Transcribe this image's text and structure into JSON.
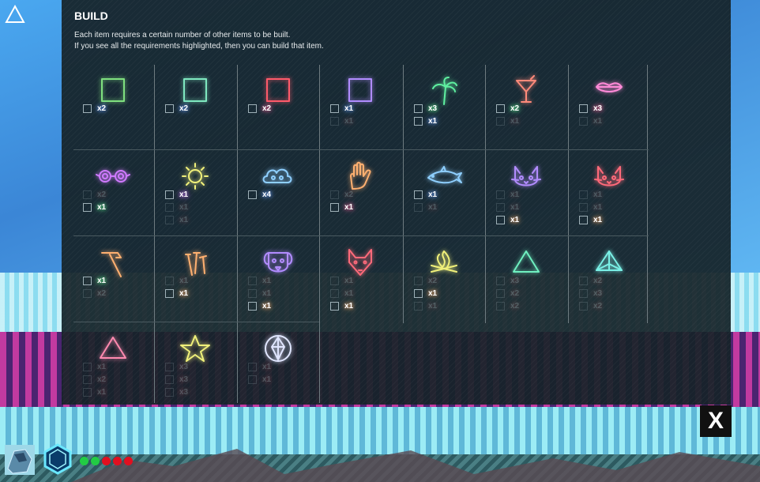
{
  "panel": {
    "title": "BUILD",
    "description_line1": "Each item requires a certain number of other items to be built.",
    "description_line2": "If you see all the requirements highlighted, then you can build that item."
  },
  "colors": {
    "green": "#6ff0a0",
    "blue": "#8ecfff",
    "red": "#ff6a7a",
    "purple": "#b28cff",
    "yellow": "#f0f07a",
    "pink": "#ff8ad8",
    "orange": "#ffb070",
    "cyan": "#7af0e6"
  },
  "items": [
    {
      "icon": "green-square-icon",
      "color": "#7fe07f",
      "reqs": [
        {
          "qty": "x2",
          "lit": true,
          "glow": "#6aa0ff"
        }
      ]
    },
    {
      "icon": "cyan-square-icon",
      "color": "#7fe8c0",
      "reqs": [
        {
          "qty": "x2",
          "lit": true,
          "glow": "#6aa0ff"
        }
      ]
    },
    {
      "icon": "red-square-icon",
      "color": "#ff5a6a",
      "reqs": [
        {
          "qty": "x2",
          "lit": true,
          "glow": "#ff6aa0"
        }
      ]
    },
    {
      "icon": "purple-square-icon",
      "color": "#b08cff",
      "reqs": [
        {
          "qty": "x1",
          "lit": true,
          "glow": "#6aa0ff"
        },
        {
          "qty": "x1",
          "lit": false,
          "glow": "#ff6a6a"
        }
      ]
    },
    {
      "icon": "palm-tree-icon",
      "color": "#5ff0a0",
      "reqs": [
        {
          "qty": "x3",
          "lit": true,
          "glow": "#6aff9a"
        },
        {
          "qty": "x1",
          "lit": true,
          "glow": "#6aa0ff"
        }
      ]
    },
    {
      "icon": "cocktail-icon",
      "color": "#ff8a7a",
      "reqs": [
        {
          "qty": "x2",
          "lit": true,
          "glow": "#6aff9a"
        },
        {
          "qty": "x1",
          "lit": false,
          "glow": "#ff6a6a"
        }
      ]
    },
    {
      "icon": "lips-icon",
      "color": "#ff8ad8",
      "reqs": [
        {
          "qty": "x3",
          "lit": true,
          "glow": "#ff6aa0"
        },
        {
          "qty": "x1",
          "lit": false,
          "glow": "#ff6a6a"
        }
      ]
    },
    {
      "icon": "spiral-glasses-icon",
      "color": "#d07aff",
      "reqs": [
        {
          "qty": "x2",
          "lit": false,
          "glow": "#ff6a6a"
        },
        {
          "qty": "x1",
          "lit": true,
          "glow": "#6aff9a"
        }
      ]
    },
    {
      "icon": "sun-icon",
      "color": "#f0f07a",
      "reqs": [
        {
          "qty": "x1",
          "lit": true,
          "glow": "#d07aff"
        },
        {
          "qty": "x1",
          "lit": false,
          "glow": "#ff6a6a"
        },
        {
          "qty": "x1",
          "lit": false,
          "glow": "#ff6a6a"
        }
      ]
    },
    {
      "icon": "cloud-icon",
      "color": "#8ecfff",
      "reqs": [
        {
          "qty": "x4",
          "lit": true,
          "glow": "#6aa0ff"
        }
      ]
    },
    {
      "icon": "hand-icon",
      "color": "#ffb070",
      "reqs": [
        {
          "qty": "x2",
          "lit": false,
          "glow": "#ff6a6a"
        },
        {
          "qty": "x1",
          "lit": true,
          "glow": "#ff6aa0"
        }
      ]
    },
    {
      "icon": "dolphin-icon",
      "color": "#8ecfff",
      "reqs": [
        {
          "qty": "x1",
          "lit": true,
          "glow": "#6aa0ff"
        },
        {
          "qty": "x1",
          "lit": false,
          "glow": "#ff6a6a"
        }
      ]
    },
    {
      "icon": "cat-icon",
      "color": "#b28cff",
      "reqs": [
        {
          "qty": "x1",
          "lit": false,
          "glow": "#ff6a6a"
        },
        {
          "qty": "x1",
          "lit": false,
          "glow": "#ff6a6a"
        },
        {
          "qty": "x1",
          "lit": true,
          "glow": "#ffb070"
        }
      ]
    },
    {
      "icon": "devil-cat-icon",
      "color": "#ff6a7a",
      "reqs": [
        {
          "qty": "x1",
          "lit": false,
          "glow": "#ff6a6a"
        },
        {
          "qty": "x1",
          "lit": false,
          "glow": "#ff6a6a"
        },
        {
          "qty": "x1",
          "lit": true,
          "glow": "#ffb070"
        }
      ]
    },
    {
      "icon": "hammer-icon",
      "color": "#ffb070",
      "reqs": [
        {
          "qty": "x1",
          "lit": true,
          "glow": "#6aff9a"
        },
        {
          "qty": "x2",
          "lit": false,
          "glow": "#ff6a6a"
        }
      ]
    },
    {
      "icon": "nails-icon",
      "color": "#ffb070",
      "reqs": [
        {
          "qty": "x1",
          "lit": false,
          "glow": "#ff6a6a"
        },
        {
          "qty": "x1",
          "lit": true,
          "glow": "#ffb070"
        }
      ]
    },
    {
      "icon": "dog-icon",
      "color": "#b28cff",
      "reqs": [
        {
          "qty": "x1",
          "lit": false,
          "glow": "#ff6a6a"
        },
        {
          "qty": "x1",
          "lit": false,
          "glow": "#ff6a6a"
        },
        {
          "qty": "x1",
          "lit": true,
          "glow": "#ffb070"
        }
      ]
    },
    {
      "icon": "fox-icon",
      "color": "#ff6a7a",
      "reqs": [
        {
          "qty": "x1",
          "lit": false,
          "glow": "#ff6a6a"
        },
        {
          "qty": "x1",
          "lit": false,
          "glow": "#ff6a6a"
        },
        {
          "qty": "x1",
          "lit": true,
          "glow": "#ffb070"
        }
      ]
    },
    {
      "icon": "campfire-icon",
      "color": "#f0f07a",
      "reqs": [
        {
          "qty": "x2",
          "lit": false,
          "glow": "#ff6a6a"
        },
        {
          "qty": "x1",
          "lit": true,
          "glow": "#ffb070"
        },
        {
          "qty": "x1",
          "lit": false,
          "glow": "#ff6a6a"
        }
      ]
    },
    {
      "icon": "green-triangle-icon",
      "color": "#6ff0c0",
      "reqs": [
        {
          "qty": "x3",
          "lit": false,
          "glow": "#ff6a6a"
        },
        {
          "qty": "x2",
          "lit": false,
          "glow": "#ff6a6a"
        },
        {
          "qty": "x2",
          "lit": false,
          "glow": "#ff6a6a"
        }
      ]
    },
    {
      "icon": "teal-pyramid-icon",
      "color": "#7af0e6",
      "reqs": [
        {
          "qty": "x2",
          "lit": false,
          "glow": "#ff6a6a"
        },
        {
          "qty": "x3",
          "lit": false,
          "glow": "#ff6a6a"
        },
        {
          "qty": "x2",
          "lit": false,
          "glow": "#ff6a6a"
        }
      ]
    },
    {
      "icon": "pink-triangle-icon",
      "color": "#ff8ab0",
      "reqs": [
        {
          "qty": "x1",
          "lit": false,
          "glow": "#ff6a6a"
        },
        {
          "qty": "x2",
          "lit": false,
          "glow": "#ff6a6a"
        },
        {
          "qty": "x1",
          "lit": false,
          "glow": "#ff6a6a"
        }
      ]
    },
    {
      "icon": "star-icon",
      "color": "#f0f07a",
      "reqs": [
        {
          "qty": "x3",
          "lit": false,
          "glow": "#ff6a6a"
        },
        {
          "qty": "x3",
          "lit": false,
          "glow": "#ff6a6a"
        },
        {
          "qty": "x3",
          "lit": false,
          "glow": "#ff6a6a"
        }
      ]
    },
    {
      "icon": "crystal-icon",
      "color": "#e0e6ff",
      "reqs": [
        {
          "qty": "x1",
          "lit": false,
          "glow": "#ff6a6a"
        },
        {
          "qty": "x1",
          "lit": false,
          "glow": "#ff6a6a"
        }
      ]
    }
  ],
  "close_button": {
    "label": "X"
  },
  "hud": {
    "status_dots": [
      "#22cc44",
      "#22cc44",
      "#e01020",
      "#e01020",
      "#e01020"
    ]
  }
}
